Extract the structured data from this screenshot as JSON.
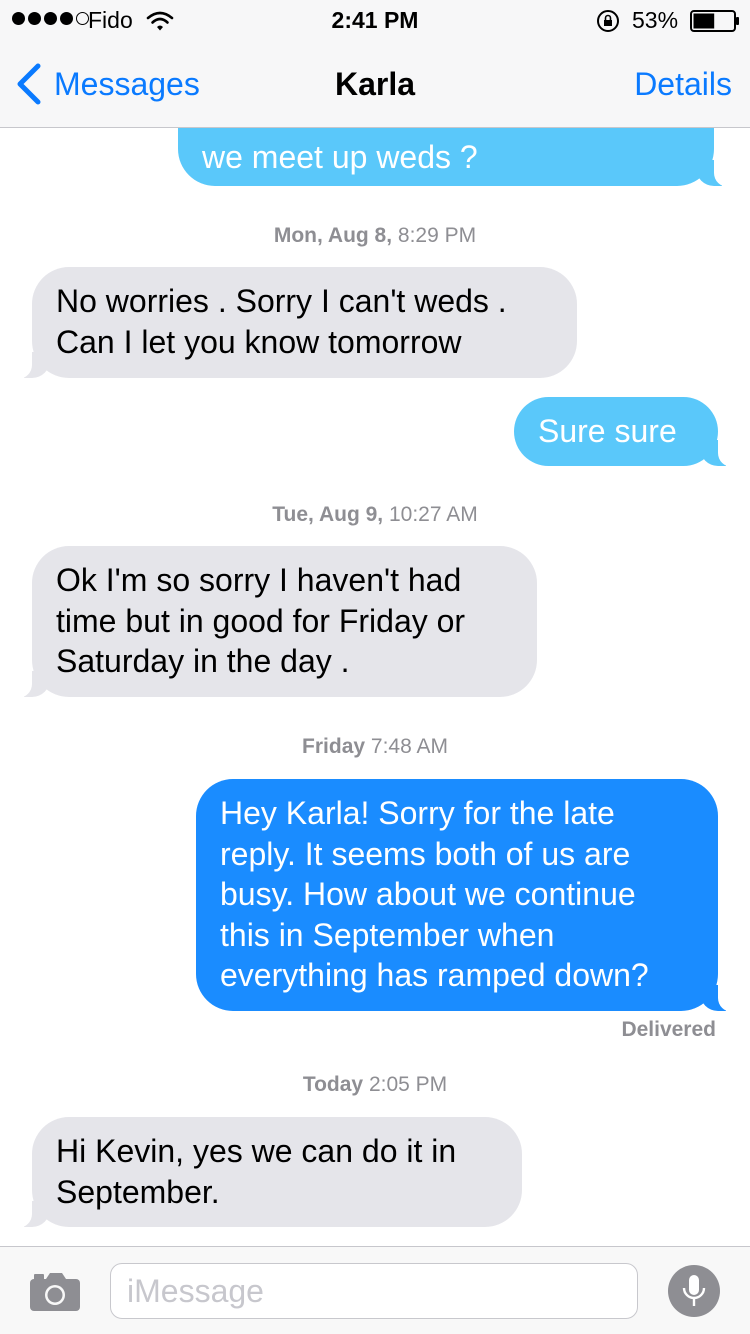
{
  "status_bar": {
    "carrier": "Fido",
    "time": "2:41 PM",
    "battery": "53%",
    "signal_bars": 4,
    "signal_max": 5,
    "battery_level": 0.53
  },
  "nav": {
    "back_label": "Messages",
    "title": "Karla",
    "details_label": "Details"
  },
  "messages": [
    {
      "type": "out",
      "text": "we meet up weds ?"
    },
    {
      "type": "timestamp",
      "day": "Mon, Aug 8,",
      "time": "8:29 PM"
    },
    {
      "type": "in",
      "lines": [
        "No worries . Sorry I can't weds .",
        "Can I let you know tomorrow"
      ]
    },
    {
      "type": "out",
      "text": "Sure sure"
    },
    {
      "type": "timestamp",
      "day": "Tue, Aug 9,",
      "time": "10:27 AM"
    },
    {
      "type": "in",
      "lines": [
        "Ok I'm so sorry I haven't had",
        "time but in good for Friday or",
        "Saturday in the day ."
      ]
    },
    {
      "type": "timestamp",
      "day": "Friday",
      "time": "7:48 AM"
    },
    {
      "type": "out",
      "lines": [
        "Hey Karla! Sorry for the late",
        "reply. It seems both of us are",
        "busy. How about we continue",
        "this in September when",
        "everything has ramped down?"
      ]
    },
    {
      "type": "status",
      "text": "Delivered"
    },
    {
      "type": "timestamp",
      "day": "Today",
      "time": "2:05 PM"
    },
    {
      "type": "in",
      "lines": [
        "Hi Kevin, yes we can do it in",
        "September."
      ]
    }
  ],
  "input": {
    "placeholder": "iMessage"
  },
  "icons": {
    "back": "chevron-left-icon",
    "wifi": "wifi-icon",
    "rotation_lock": "rotation-lock-icon",
    "battery": "battery-icon",
    "camera": "camera-icon",
    "mic": "microphone-icon"
  },
  "colors": {
    "accent": "#0a7aff",
    "incoming_bubble": "#e5e5ea",
    "outgoing_bubble_light": "#5ac8fa",
    "outgoing_bubble": "#1a8cff",
    "meta_text": "#8e8e93"
  }
}
